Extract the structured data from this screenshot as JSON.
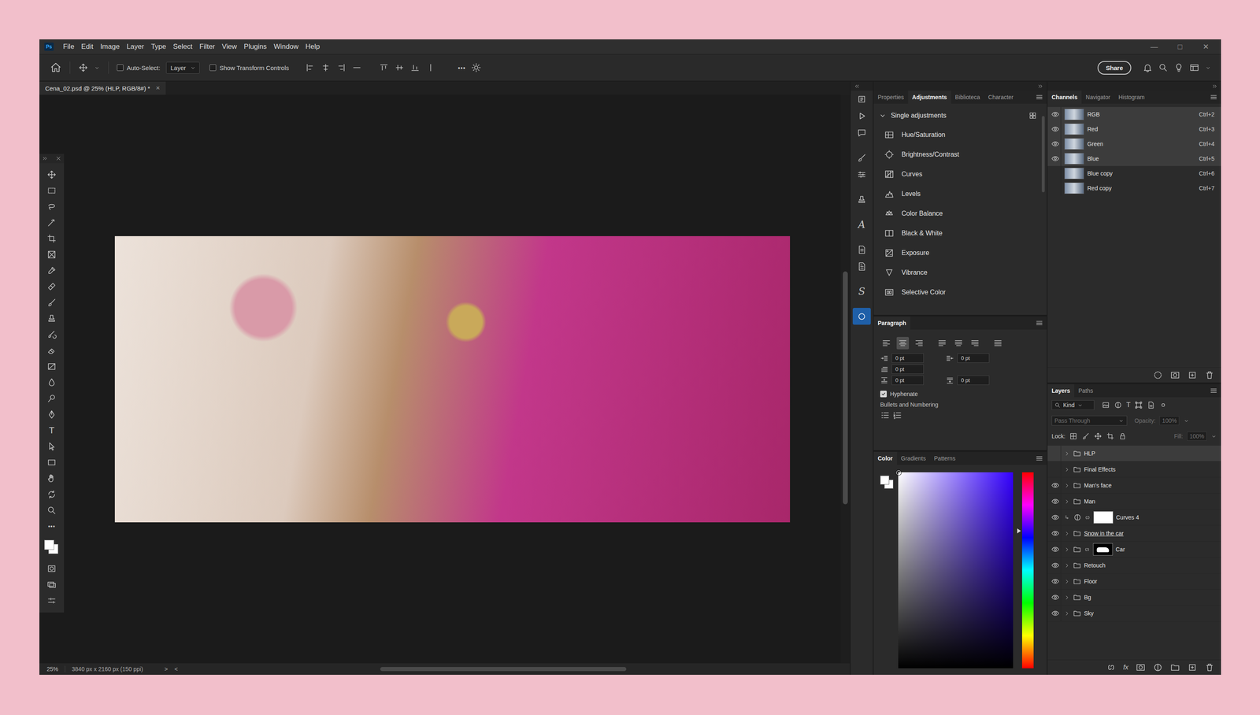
{
  "app": {
    "logo": "Ps",
    "menu": [
      "File",
      "Edit",
      "Image",
      "Layer",
      "Type",
      "Select",
      "Filter",
      "View",
      "Plugins",
      "Window",
      "Help"
    ],
    "window_controls": [
      "—",
      "□",
      "✕"
    ]
  },
  "options_bar": {
    "auto_select": {
      "label": "Auto-Select:",
      "checked": false
    },
    "target": "Layer",
    "transform_controls": {
      "label": "Show Transform Controls",
      "checked": false
    },
    "more": "•••",
    "share": "Share"
  },
  "document": {
    "title": "Cena_02.psd @ 25% (HLP, RGB/8#) *",
    "close": "×"
  },
  "toolbar": {
    "type_glyph": "T",
    "more": "•••"
  },
  "status_bar": {
    "zoom": "25%",
    "info": "3840 px x 2160 px (150 ppi)",
    "next": ">",
    "prev": "<"
  },
  "icon_strip": {
    "items": [
      {
        "kind": "icon",
        "selected": false
      },
      {
        "kind": "icon",
        "selected": false
      },
      {
        "kind": "icon",
        "selected": false
      },
      {
        "kind": "icon",
        "selected": false
      },
      {
        "kind": "icon",
        "selected": false
      },
      {
        "kind": "icon",
        "selected": false
      },
      {
        "kind": "glyph",
        "glyph": "A",
        "selected": false
      },
      {
        "kind": "icon",
        "selected": false
      },
      {
        "kind": "icon",
        "selected": false
      },
      {
        "kind": "glyph",
        "glyph": "S",
        "selected": false
      },
      {
        "kind": "icon",
        "selected": true
      }
    ]
  },
  "adjustments": {
    "tabs": [
      {
        "label": "Properties",
        "selected": false
      },
      {
        "label": "Adjustments",
        "selected": true
      },
      {
        "label": "Biblioteca",
        "selected": false
      },
      {
        "label": "Character",
        "selected": false
      }
    ],
    "section": {
      "label": "Single adjustments",
      "expanded": true
    },
    "items": [
      "Hue/Saturation",
      "Brightness/Contrast",
      "Curves",
      "Levels",
      "Color Balance",
      "Black & White",
      "Exposure",
      "Vibrance",
      "Selective Color"
    ]
  },
  "paragraph": {
    "tabs": [
      {
        "label": "Paragraph",
        "selected": true
      }
    ],
    "alignments": [
      {
        "selected": false
      },
      {
        "selected": true
      },
      {
        "selected": false
      },
      {
        "selected": false
      },
      {
        "selected": false
      },
      {
        "selected": false
      },
      {
        "selected": false
      }
    ],
    "left_fields": [
      "0 pt",
      "0 pt",
      "0 pt"
    ],
    "right_fields": [
      "0 pt",
      "0 pt"
    ],
    "hyphenate": {
      "label": "Hyphenate",
      "checked": true
    },
    "bullets": {
      "label": "Bullets and Numbering"
    }
  },
  "color": {
    "tabs": [
      {
        "label": "Color",
        "selected": true
      },
      {
        "label": "Gradients",
        "selected": false
      },
      {
        "label": "Patterns",
        "selected": false
      }
    ],
    "hue_level": 0.3
  },
  "channels": {
    "tabs": [
      {
        "label": "Channels",
        "selected": true
      },
      {
        "label": "Navigator",
        "selected": false
      },
      {
        "label": "Histogram",
        "selected": false
      }
    ],
    "rows": [
      {
        "name": "RGB",
        "shortcut": "Ctrl+2",
        "visible": true,
        "selected": true
      },
      {
        "name": "Red",
        "shortcut": "Ctrl+3",
        "visible": true,
        "selected": true
      },
      {
        "name": "Green",
        "shortcut": "Ctrl+4",
        "visible": true,
        "selected": true
      },
      {
        "name": "Blue",
        "shortcut": "Ctrl+5",
        "visible": true,
        "selected": true
      },
      {
        "name": "Blue copy",
        "shortcut": "Ctrl+6",
        "visible": false,
        "selected": false
      },
      {
        "name": "Red copy",
        "shortcut": "Ctrl+7",
        "visible": false,
        "selected": false
      }
    ]
  },
  "layers": {
    "tabs": [
      {
        "label": "Layers",
        "selected": true
      },
      {
        "label": "Paths",
        "selected": false
      }
    ],
    "filter": "Kind",
    "filter_type_glyph": "T",
    "blend_mode": {
      "label": "Pass Through",
      "disabled": true
    },
    "opacity": {
      "label": "Opacity:",
      "value": "100%",
      "disabled": true
    },
    "lock_label": "Lock:",
    "fill": {
      "label": "Fill:",
      "value": "100%",
      "disabled": true
    },
    "bottom_fx": "fx",
    "rows": [
      {
        "name": "HLP",
        "kind": "group",
        "visible": false,
        "selected": true,
        "clipped": false,
        "clip_base": false
      },
      {
        "name": "Final Effects",
        "kind": "group",
        "visible": false,
        "selected": false,
        "clipped": false,
        "clip_base": false
      },
      {
        "name": "Man's face",
        "kind": "group",
        "visible": true,
        "selected": false,
        "clipped": false,
        "clip_base": false
      },
      {
        "name": "Man",
        "kind": "group",
        "visible": true,
        "selected": false,
        "clipped": false,
        "clip_base": false
      },
      {
        "name": "Curves 4",
        "kind": "adjustment",
        "visible": true,
        "selected": false,
        "clipped": true,
        "clip_base": false
      },
      {
        "name": "Snow in the car",
        "kind": "group",
        "visible": true,
        "selected": false,
        "clipped": false,
        "clip_base": true
      },
      {
        "name": "Car",
        "kind": "masked_group",
        "visible": true,
        "selected": false,
        "clipped": false,
        "clip_base": false
      },
      {
        "name": "Retouch",
        "kind": "group",
        "visible": true,
        "selected": false,
        "clipped": false,
        "clip_base": false
      },
      {
        "name": "Floor",
        "kind": "group",
        "visible": true,
        "selected": false,
        "clipped": false,
        "clip_base": false
      },
      {
        "name": "Bg",
        "kind": "group",
        "visible": true,
        "selected": false,
        "clipped": false,
        "clip_base": false
      },
      {
        "name": "Sky",
        "kind": "group",
        "visible": true,
        "selected": false,
        "clipped": false,
        "clip_base": false
      }
    ]
  }
}
